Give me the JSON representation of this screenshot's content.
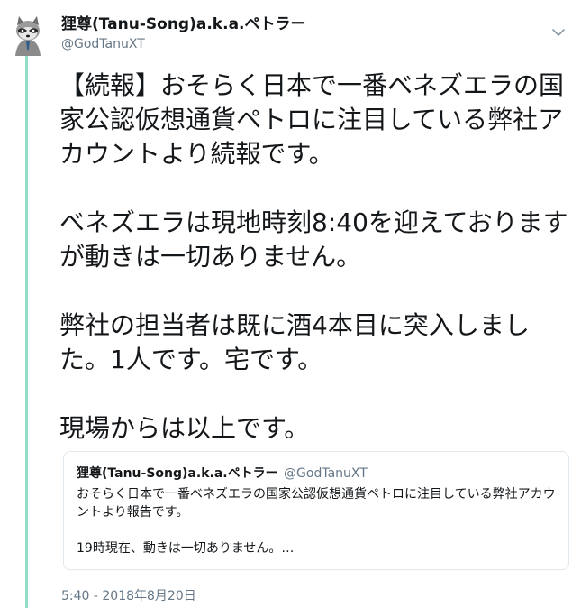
{
  "tweet": {
    "display_name": "狸尊(Tanu-Song)a.k.a.ペトラー",
    "handle": "@GodTanuXT",
    "paragraphs": [
      "【続報】おそらく日本で一番ベネズエラの国家公認仮想通貨ペトロに注目している弊社アカウントより続報です。",
      "ベネズエラは現地時刻8:40を迎えておりますが動きは一切ありません。",
      "弊社の担当者は既に酒4本目に突入しました。1人です。宅です。",
      "現場からは以上です。"
    ],
    "timestamp": "5:40 - 2018年8月20日",
    "menu_icon": "chevron-down-icon",
    "thread_color": "#8fdcc7"
  },
  "quoted_tweet": {
    "display_name": "狸尊(Tanu-Song)a.k.a.ペトラー",
    "handle": "@GodTanuXT",
    "body": "おそらく日本で一番ベネズエラの国家公認仮想通貨ペトロに注目している弊社アカウントより報告です。\n\n19時現在、動きは一切ありません。…"
  }
}
